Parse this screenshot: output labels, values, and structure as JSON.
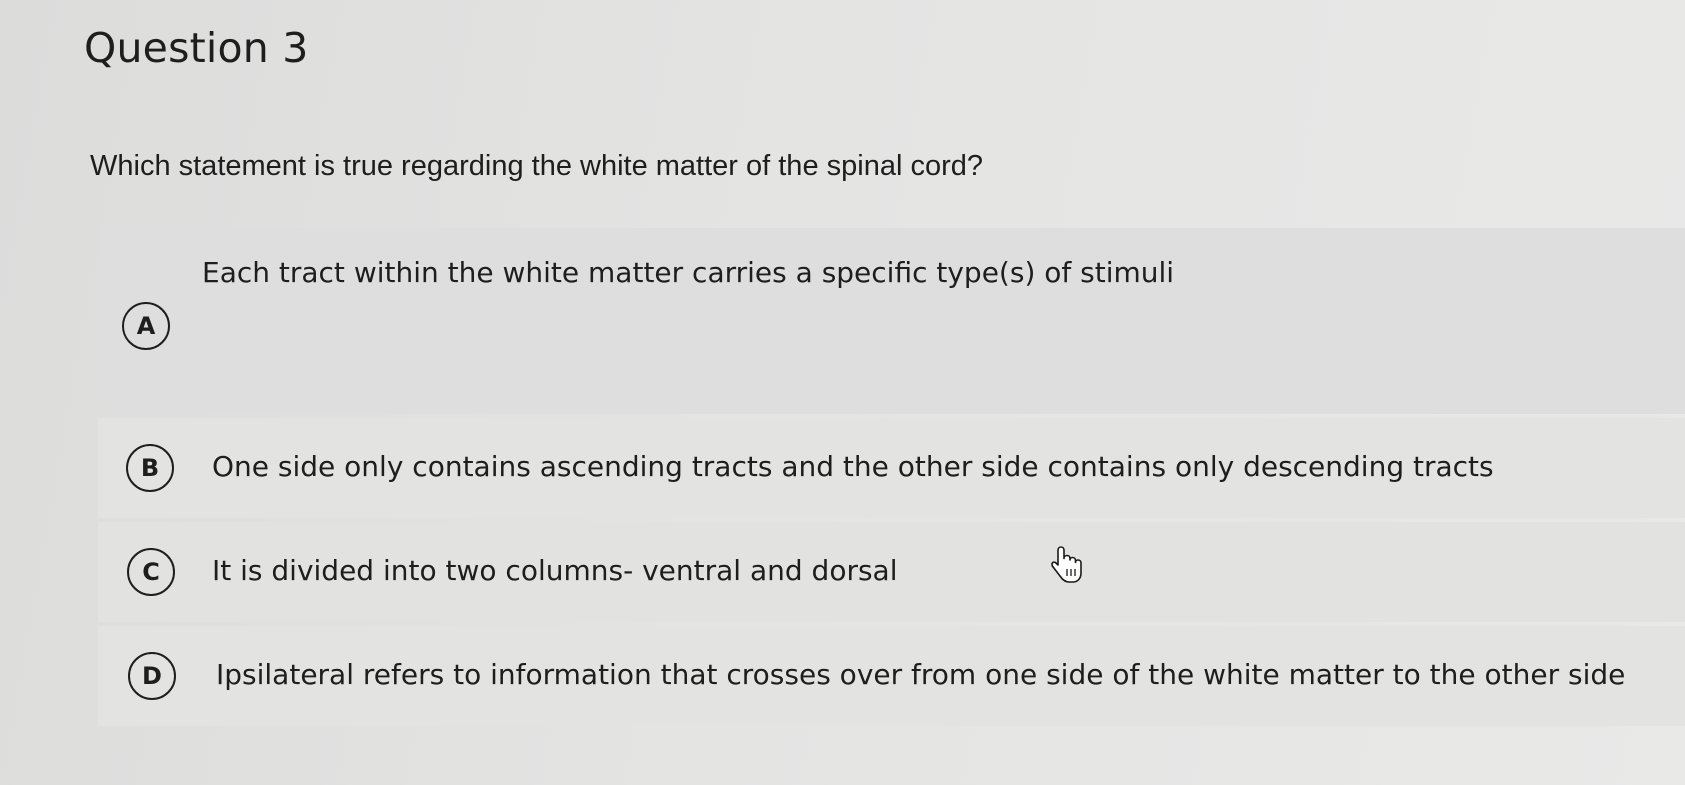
{
  "question": {
    "title": "Question 3",
    "prompt": "Which statement is true regarding the white matter of the spinal cord?"
  },
  "options": [
    {
      "letter": "A",
      "text": "Each tract within the white matter carries a specific type(s) of stimuli"
    },
    {
      "letter": "B",
      "text": "One side only contains ascending tracts and the other side contains only descending tracts"
    },
    {
      "letter": "C",
      "text": "It is divided into two columns- ventral and dorsal"
    },
    {
      "letter": "D",
      "text": "Ipsilateral refers to information that crosses over from one side of the white matter to the other side"
    }
  ],
  "cursor": {
    "icon": "hand-pointer-icon"
  }
}
